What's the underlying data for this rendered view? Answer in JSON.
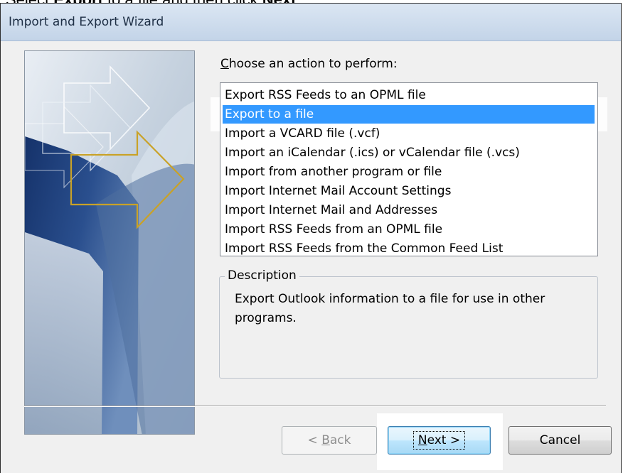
{
  "caption": {
    "part1": "Select ",
    "bold1": "Export",
    "part2": " to a file and then click ",
    "bold2": "Next"
  },
  "window": {
    "title": "Import and Export Wizard"
  },
  "prompt": {
    "accelerator": "C",
    "rest": "hoose an action to perform:"
  },
  "actions": {
    "items": [
      "Export RSS Feeds to an OPML file",
      "Export to a file",
      "Import a VCARD file (.vcf)",
      "Import an iCalendar (.ics) or vCalendar file (.vcs)",
      "Import from another program or file",
      "Import Internet Mail Account Settings",
      "Import Internet Mail and Addresses",
      "Import RSS Feeds from an OPML file",
      "Import RSS Feeds from the Common Feed List"
    ],
    "selected_index": 1
  },
  "description": {
    "legend": "Description",
    "text": "Export Outlook information to a file for use in other programs."
  },
  "buttons": {
    "back_prefix": "< ",
    "back_accel": "B",
    "back_rest": "ack",
    "next_accel": "N",
    "next_rest": "ext >",
    "cancel": "Cancel"
  },
  "colors": {
    "selection": "#3399ff",
    "titlebar": "#c3d4e8",
    "window_bg": "#f0f0f0"
  }
}
